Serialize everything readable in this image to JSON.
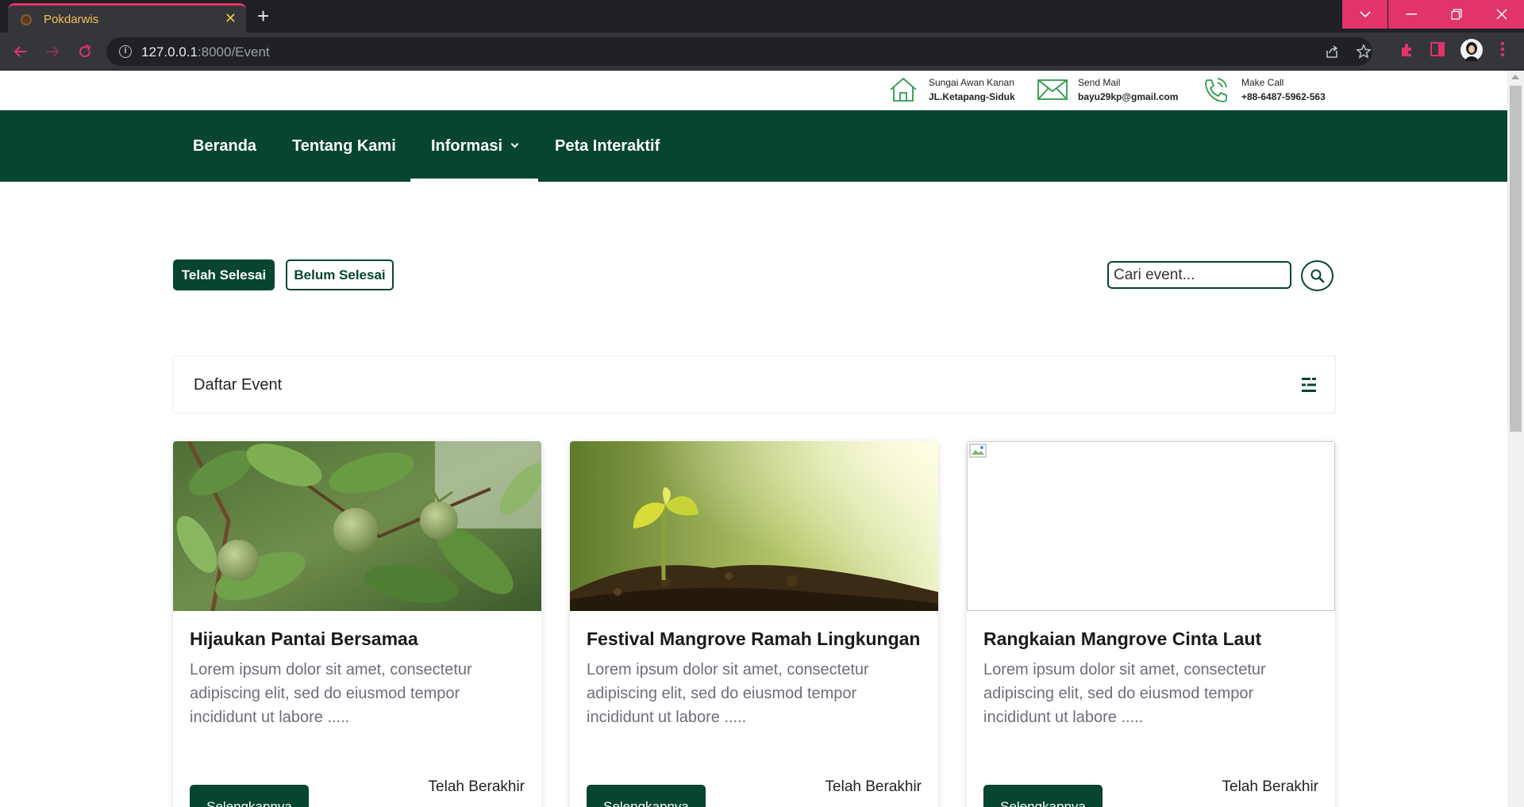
{
  "browser": {
    "tab_title": "Pokdarwis",
    "tab_close": "✕",
    "new_tab": "+",
    "url_host": "127.0.0.1",
    "url_path": ":8000/Event"
  },
  "contacts": [
    {
      "icon": "home-icon",
      "label": "Sungai Awan Kanan",
      "value": "JL.Ketapang-Siduk"
    },
    {
      "icon": "mail-icon",
      "label": "Send Mail",
      "value": "bayu29kp@gmail.com"
    },
    {
      "icon": "phone-icon",
      "label": "Make Call",
      "value": "+88-6487-5962-563"
    }
  ],
  "nav": {
    "items": [
      "Beranda",
      "Tentang Kami",
      "Informasi",
      "Peta Interaktif"
    ],
    "active": "Informasi"
  },
  "filters": {
    "done": "Telah Selesai",
    "not_done": "Belum Selesai"
  },
  "search": {
    "placeholder": "Cari event..."
  },
  "list": {
    "title": "Daftar Event"
  },
  "events": [
    {
      "title": "Hijaukan Pantai Bersamaa",
      "desc": "Lorem ipsum dolor sit amet, consectetur adipiscing elit, sed do eiusmod tempor incididunt ut labore .....",
      "button": "Selengkapnya",
      "status": "Telah Berakhir",
      "image": "mangrove-fruit"
    },
    {
      "title": "Festival Mangrove Ramah Lingkungan",
      "desc": "Lorem ipsum dolor sit amet, consectetur adipiscing elit, sed do eiusmod tempor incididunt ut labore .....",
      "button": "Selengkapnya",
      "status": "Telah Berakhir",
      "image": "sprout"
    },
    {
      "title": "Rangkaian Mangrove Cinta Laut",
      "desc": "Lorem ipsum dolor sit amet, consectetur adipiscing elit, sed do eiusmod tempor incididunt ut labore .....",
      "button": "Selengkapnya",
      "status": "Telah Berakhir",
      "image": "broken-image"
    }
  ],
  "colors": {
    "brand_green": "#064532",
    "chrome_accent": "#e2336b"
  }
}
